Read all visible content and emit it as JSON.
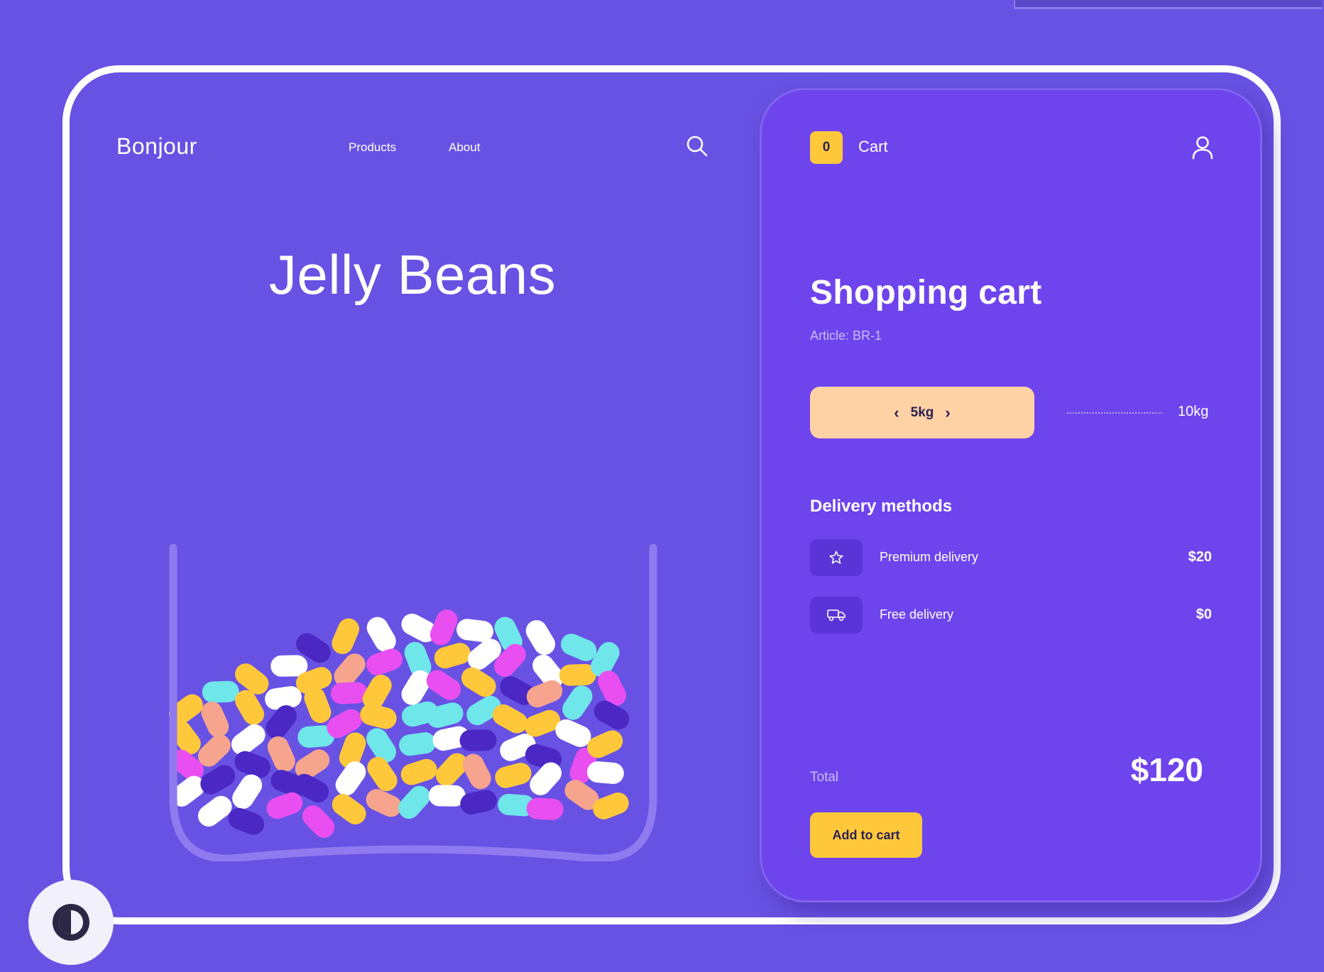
{
  "header": {
    "brand": "Bonjour",
    "nav": [
      "Products",
      "About"
    ]
  },
  "product": {
    "title": "Jelly Beans"
  },
  "cart": {
    "count": "0",
    "label": "Cart",
    "title": "Shopping cart",
    "article": "Article: BR-1",
    "weight": {
      "selected": "5kg",
      "max": "10kg",
      "fraction": 0.5
    },
    "delivery": {
      "heading": "Delivery methods",
      "methods": [
        {
          "name": "Premium delivery",
          "price": "$20",
          "icon": "star-icon"
        },
        {
          "name": "Free delivery",
          "price": "$0",
          "icon": "truck-icon"
        }
      ]
    },
    "total_label": "Total",
    "total_value": "$120",
    "add_button": "Add to cart"
  },
  "colors": {
    "background": "#6852e3",
    "panel": "#6e44ed",
    "accent_yellow": "#ffc83a",
    "pill_peach": "#ffd2a5",
    "bean_colors": [
      "#ffc83a",
      "#e94ff0",
      "#ffffff",
      "#6fe6ea",
      "#4b27c4",
      "#f6a48e"
    ]
  },
  "icons": {
    "search": "search-icon",
    "user": "user-icon",
    "theme": "contrast-icon"
  }
}
